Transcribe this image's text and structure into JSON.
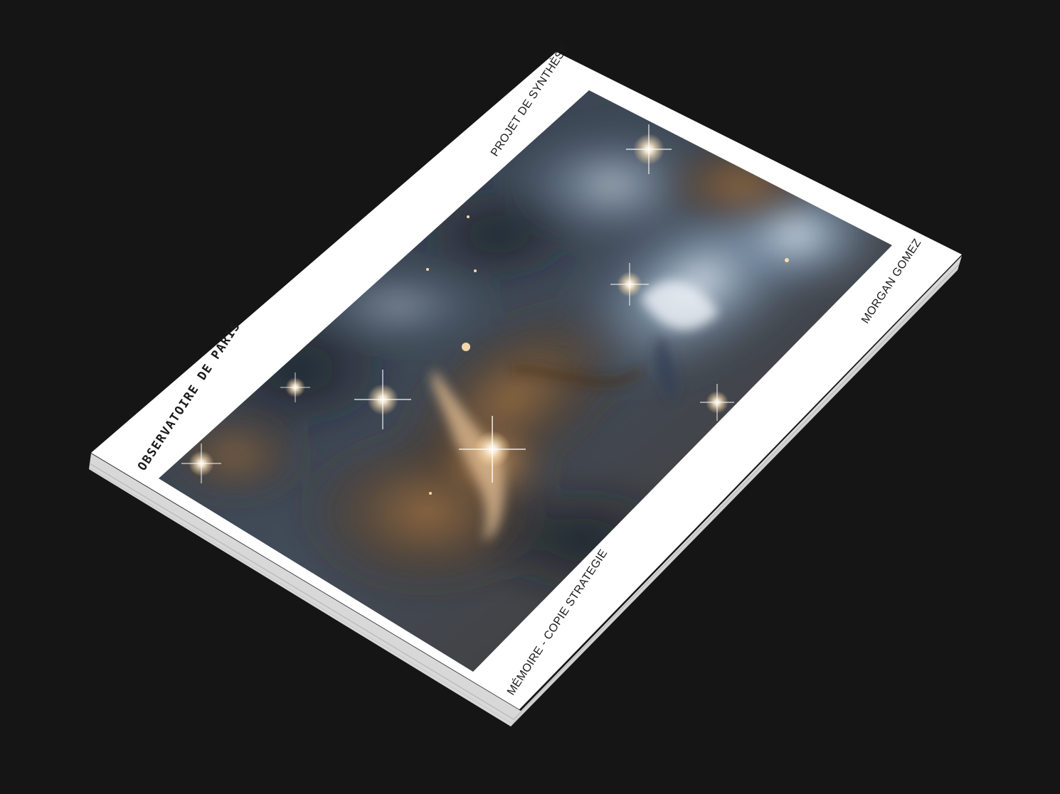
{
  "background_color": "#151515",
  "booklet": {
    "cover_title": "OBSERVATOIRE DE PARIS",
    "top_label": "PROJET DE SYNTHÈSE",
    "author_label": "MORGAN GOMEZ",
    "bottom_label": "MÉMOIRE - COPIE STRATEGIE",
    "cover_color": "#ffffff",
    "photo_subject": "nebula-with-stars"
  }
}
